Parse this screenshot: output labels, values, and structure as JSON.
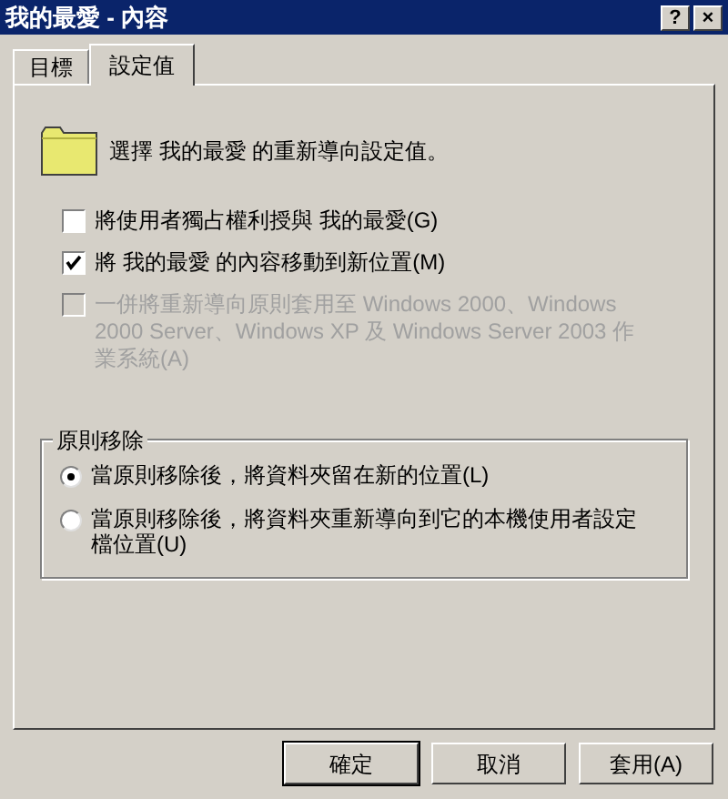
{
  "window": {
    "title": "我的最愛 - 內容",
    "controls": [
      "?",
      "×"
    ]
  },
  "tabs": [
    {
      "label": "目標",
      "selected": false
    },
    {
      "label": "設定值",
      "selected": true
    }
  ],
  "heading": "選擇 我的最愛 的重新導向設定值。",
  "options": [
    {
      "label": "將使用者獨占權利授與 我的最愛(G)",
      "checked": false,
      "disabled": false
    },
    {
      "label": "將 我的最愛 的內容移動到新位置(M)",
      "checked": true,
      "disabled": false
    },
    {
      "label": "一併將重新導向原則套用至 Windows 2000、Windows 2000 Server、Windows XP 及 Windows Server 2003 作業系統(A)",
      "checked": false,
      "disabled": true
    }
  ],
  "policy_removal": {
    "title": "原則移除",
    "choices": [
      {
        "label": "當原則移除後，將資料夾留在新的位置(L)",
        "selected": true
      },
      {
        "label": "當原則移除後，將資料夾重新導向到它的本機使用者設定檔位置(U)",
        "selected": false
      }
    ]
  },
  "buttons": [
    "確定",
    "取消",
    "套用(A)"
  ]
}
